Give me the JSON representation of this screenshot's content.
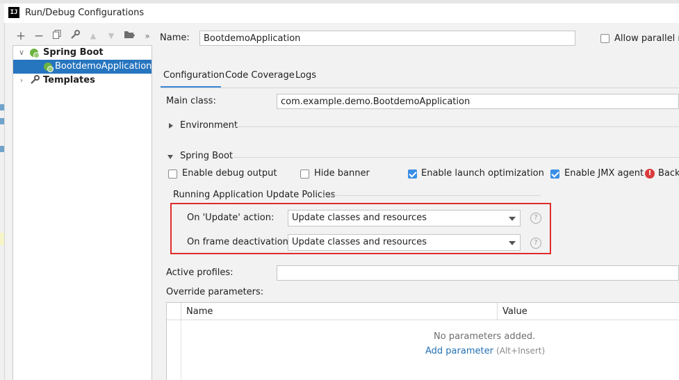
{
  "window": {
    "title": "Run/Debug Configurations",
    "logo": "IJ"
  },
  "toolbar": {
    "icons": [
      "add-icon",
      "remove-icon",
      "copy-icon",
      "wrench-icon",
      "move-up-icon",
      "move-down-icon",
      "folder-icon",
      "more-icon"
    ]
  },
  "tree": {
    "items": [
      {
        "label": "Spring Boot"
      },
      {
        "label": "BootdemoApplication"
      },
      {
        "label": "Templates"
      }
    ]
  },
  "name": {
    "label": "Name:",
    "value": "BootdemoApplication"
  },
  "allow_parallel": {
    "label": "Allow parallel ru",
    "checked": false
  },
  "tabs": [
    "Configuration",
    "Code Coverage",
    "Logs"
  ],
  "main_class": {
    "label": "Main class:",
    "value": "com.example.demo.BootdemoApplication"
  },
  "environment": {
    "label": "Environment"
  },
  "spring_boot": {
    "label": "Spring Boot",
    "options": [
      {
        "label": "Enable debug output",
        "checked": false
      },
      {
        "label": "Hide banner",
        "checked": false
      },
      {
        "label": "Enable launch optimization",
        "checked": true
      },
      {
        "label": "Enable JMX agent",
        "checked": true
      },
      {
        "label": "Backg",
        "warning": true
      }
    ]
  },
  "update_policies": {
    "title": "Running Application Update Policies",
    "on_update": {
      "label": "On 'Update' action:",
      "value": "Update classes and resources"
    },
    "on_frame": {
      "label": "On frame deactivation:",
      "value": "Update classes and resources"
    },
    "highlight_color": "#e02b2b"
  },
  "active_profiles": {
    "label": "Active profiles:",
    "value": ""
  },
  "override": {
    "label": "Override parameters:",
    "columns": [
      "Name",
      "Value"
    ],
    "empty_text": "No parameters added.",
    "add_link": "Add parameter",
    "add_shortcut": "(Alt+Insert)"
  },
  "colors": {
    "selection": "#2675bf",
    "accent": "#3a8ee6",
    "link": "#2470b3"
  }
}
